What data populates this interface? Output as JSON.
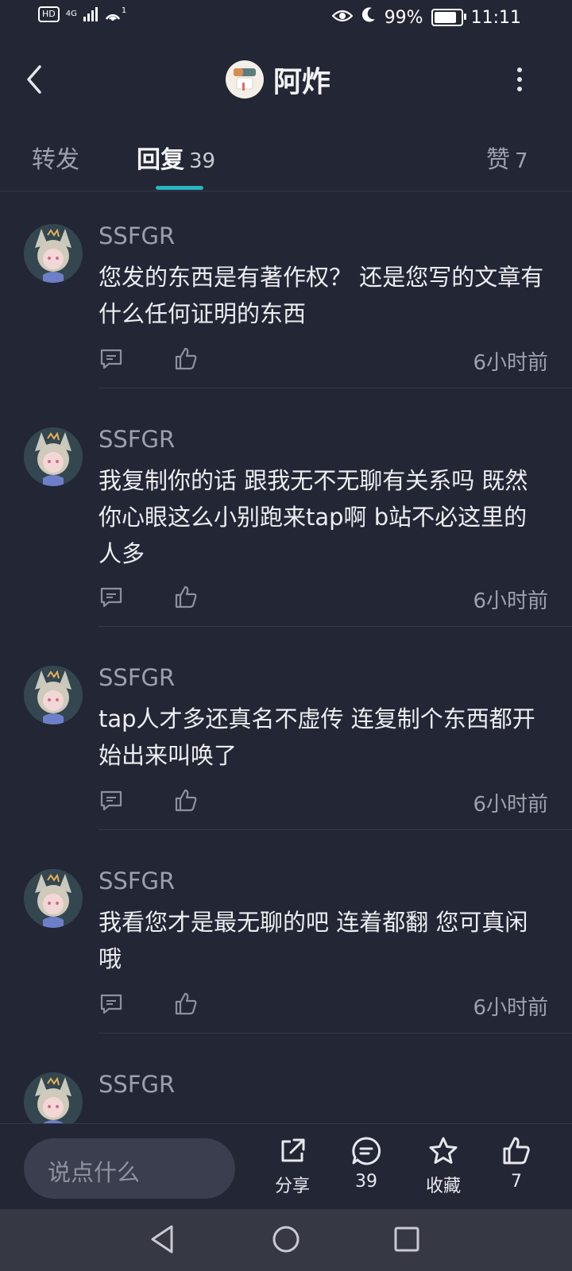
{
  "status_bar": {
    "hd": "HD",
    "network": "4G",
    "hotspot_count": "1",
    "battery_percent": "99%",
    "battery_level": 0.99,
    "time": "11:11"
  },
  "header": {
    "title": "阿炸"
  },
  "tabs": {
    "forward": "转发",
    "reply": "回复",
    "reply_count": "39",
    "like": "赞",
    "like_count": "7"
  },
  "comments": [
    {
      "user": "SSFGR",
      "text": "您发的东西是有著作权？ 还是您写的文章有什么任何证明的东西",
      "time": "6小时前"
    },
    {
      "user": "SSFGR",
      "text": "我复制你的话 跟我无不无聊有关系吗 既然你心眼这么小别跑来tap啊 b站不必这里的人多",
      "time": "6小时前"
    },
    {
      "user": "SSFGR",
      "text": "tap人才多还真名不虚传 连复制个东西都开始出来叫唤了",
      "time": "6小时前"
    },
    {
      "user": "SSFGR",
      "text": "我看您才是最无聊的吧 连着都翻 您可真闲哦",
      "time": "6小时前"
    },
    {
      "user": "SSFGR",
      "text": "",
      "time": ""
    }
  ],
  "bottom_bar": {
    "input_placeholder": "说点什么",
    "share": "分享",
    "comment_count": "39",
    "favorite": "收藏",
    "like_count": "7"
  },
  "colors": {
    "background": "#232634",
    "accent": "#2bb3c0",
    "navbar": "#363844"
  }
}
